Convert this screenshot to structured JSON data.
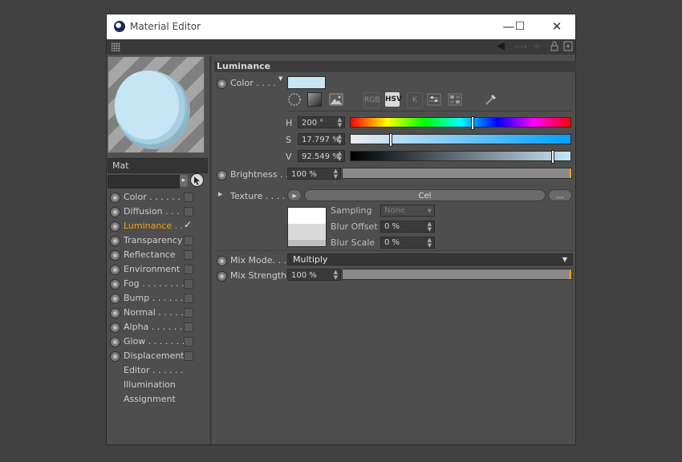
{
  "window": {
    "title": "Material Editor",
    "minimize_symbol": "—",
    "maximize_symbol": "☐",
    "close_symbol": "✕"
  },
  "material": {
    "name": "Mat"
  },
  "channels": [
    {
      "label": "Color",
      "dots": " . . . . . .",
      "checked": false,
      "active": false
    },
    {
      "label": "Diffusion",
      "dots": " . . .",
      "checked": false,
      "active": false
    },
    {
      "label": "Luminance",
      "dots": " . .",
      "checked": true,
      "active": true
    },
    {
      "label": "Transparency",
      "dots": "",
      "checked": false,
      "active": false
    },
    {
      "label": "Reflectance",
      "dots": "",
      "checked": false,
      "active": false
    },
    {
      "label": "Environment",
      "dots": "",
      "checked": false,
      "active": false
    },
    {
      "label": "Fog",
      "dots": " . . . . . . . .",
      "checked": false,
      "active": false
    },
    {
      "label": "Bump",
      "dots": " . . . . . .",
      "checked": false,
      "active": false
    },
    {
      "label": "Normal",
      "dots": " . . . . .",
      "checked": false,
      "active": false
    },
    {
      "label": "Alpha",
      "dots": " . . . . . .",
      "checked": false,
      "active": false
    },
    {
      "label": "Glow",
      "dots": " . . . . . . .",
      "checked": false,
      "active": false
    },
    {
      "label": "Displacement",
      "dots": "",
      "checked": false,
      "active": false
    }
  ],
  "extras": [
    {
      "label": "Editor . . . . . ."
    },
    {
      "label": "Illumination"
    },
    {
      "label": "Assignment"
    }
  ],
  "luminance": {
    "section_title": "Luminance",
    "color_label": "Color . . . .",
    "swatch_color": "#c6e6f6",
    "mode_rgb": "RGB",
    "mode_hsv": "HSV",
    "mode_k": "K",
    "h": {
      "label": "H",
      "value": "200 °",
      "fraction": 0.5556
    },
    "s": {
      "label": "S",
      "value": "17.797 %",
      "fraction": 0.178
    },
    "v": {
      "label": "V",
      "value": "92.549 %",
      "fraction": 0.925
    },
    "brightness": {
      "label": "Brightness . .",
      "value": "100 %",
      "fraction": 1.0
    },
    "texture": {
      "label": "Texture . . . . .",
      "shader": "Cel",
      "more": "..."
    },
    "sampling": {
      "label": "Sampling",
      "value": "None"
    },
    "blur_offset": {
      "label": "Blur Offset",
      "value": "0 %"
    },
    "blur_scale": {
      "label": "Blur Scale",
      "value": "0 %"
    },
    "mix_mode": {
      "label": "Mix Mode. . .",
      "value": "Multiply"
    },
    "mix_strength": {
      "label": "Mix Strength",
      "value": "100 %",
      "fraction": 1.0
    }
  },
  "colors": {
    "accent": "#f2a21a",
    "hue_selected": "#00a0ff"
  }
}
